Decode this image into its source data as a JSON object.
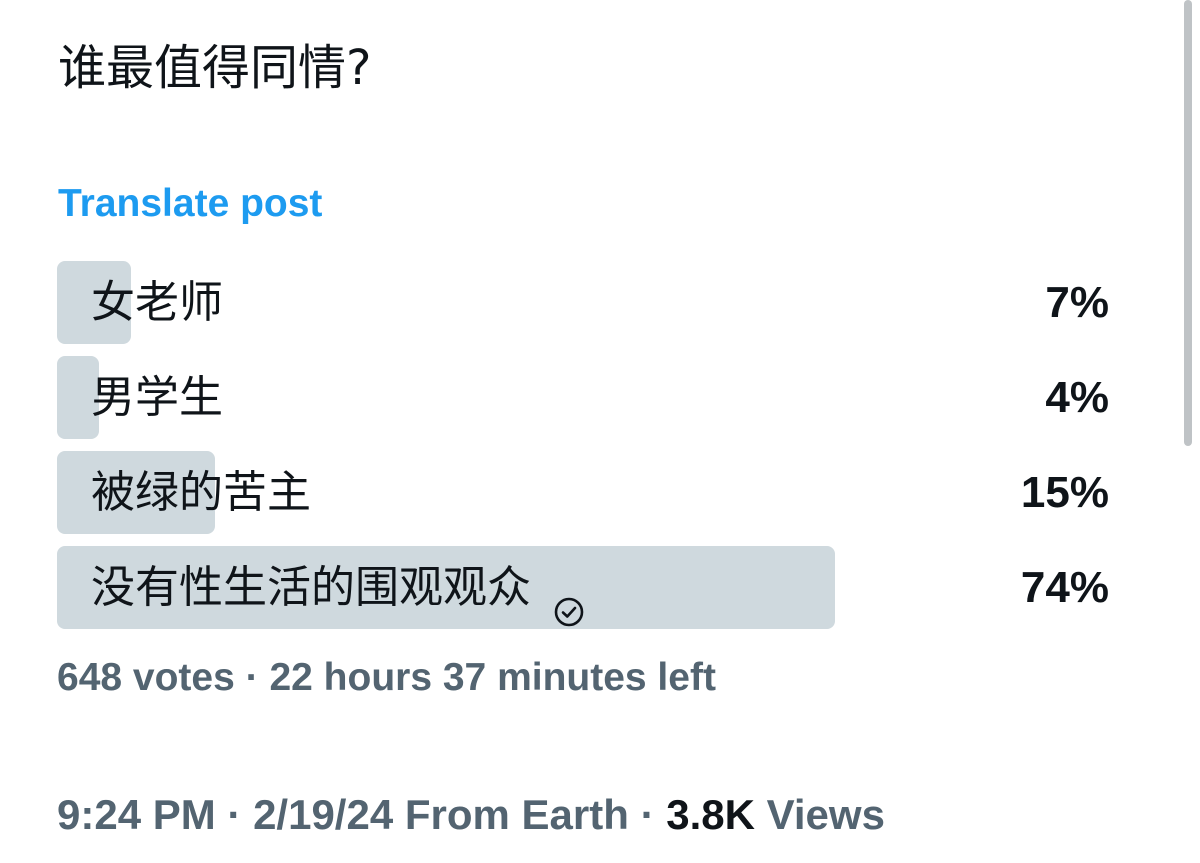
{
  "post": {
    "text": "谁最值得同情?",
    "translate_label": "Translate post"
  },
  "poll": {
    "options": [
      {
        "label": "女老师",
        "percent_label": "7%",
        "percent": 7,
        "selected": false
      },
      {
        "label": "男学生",
        "percent_label": "4%",
        "percent": 4,
        "selected": false
      },
      {
        "label": "被绿的苦主",
        "percent_label": "15%",
        "percent": 15,
        "selected": false
      },
      {
        "label": "没有性生活的围观观众",
        "percent_label": "74%",
        "percent": 74,
        "selected": true
      }
    ],
    "votes": "648 votes",
    "separator": " · ",
    "time_left": "22 hours 37 minutes left",
    "bar_color": "#cfd9de",
    "check_icon": "check-circle-icon"
  },
  "meta": {
    "time": "9:24 PM",
    "separator": " · ",
    "date": "2/19/24",
    "source": "From Earth",
    "views_count": "3.8K",
    "views_label": "Views"
  },
  "colors": {
    "accent": "#1d9bf0",
    "text_primary": "#0f1419",
    "text_secondary": "#536471"
  }
}
